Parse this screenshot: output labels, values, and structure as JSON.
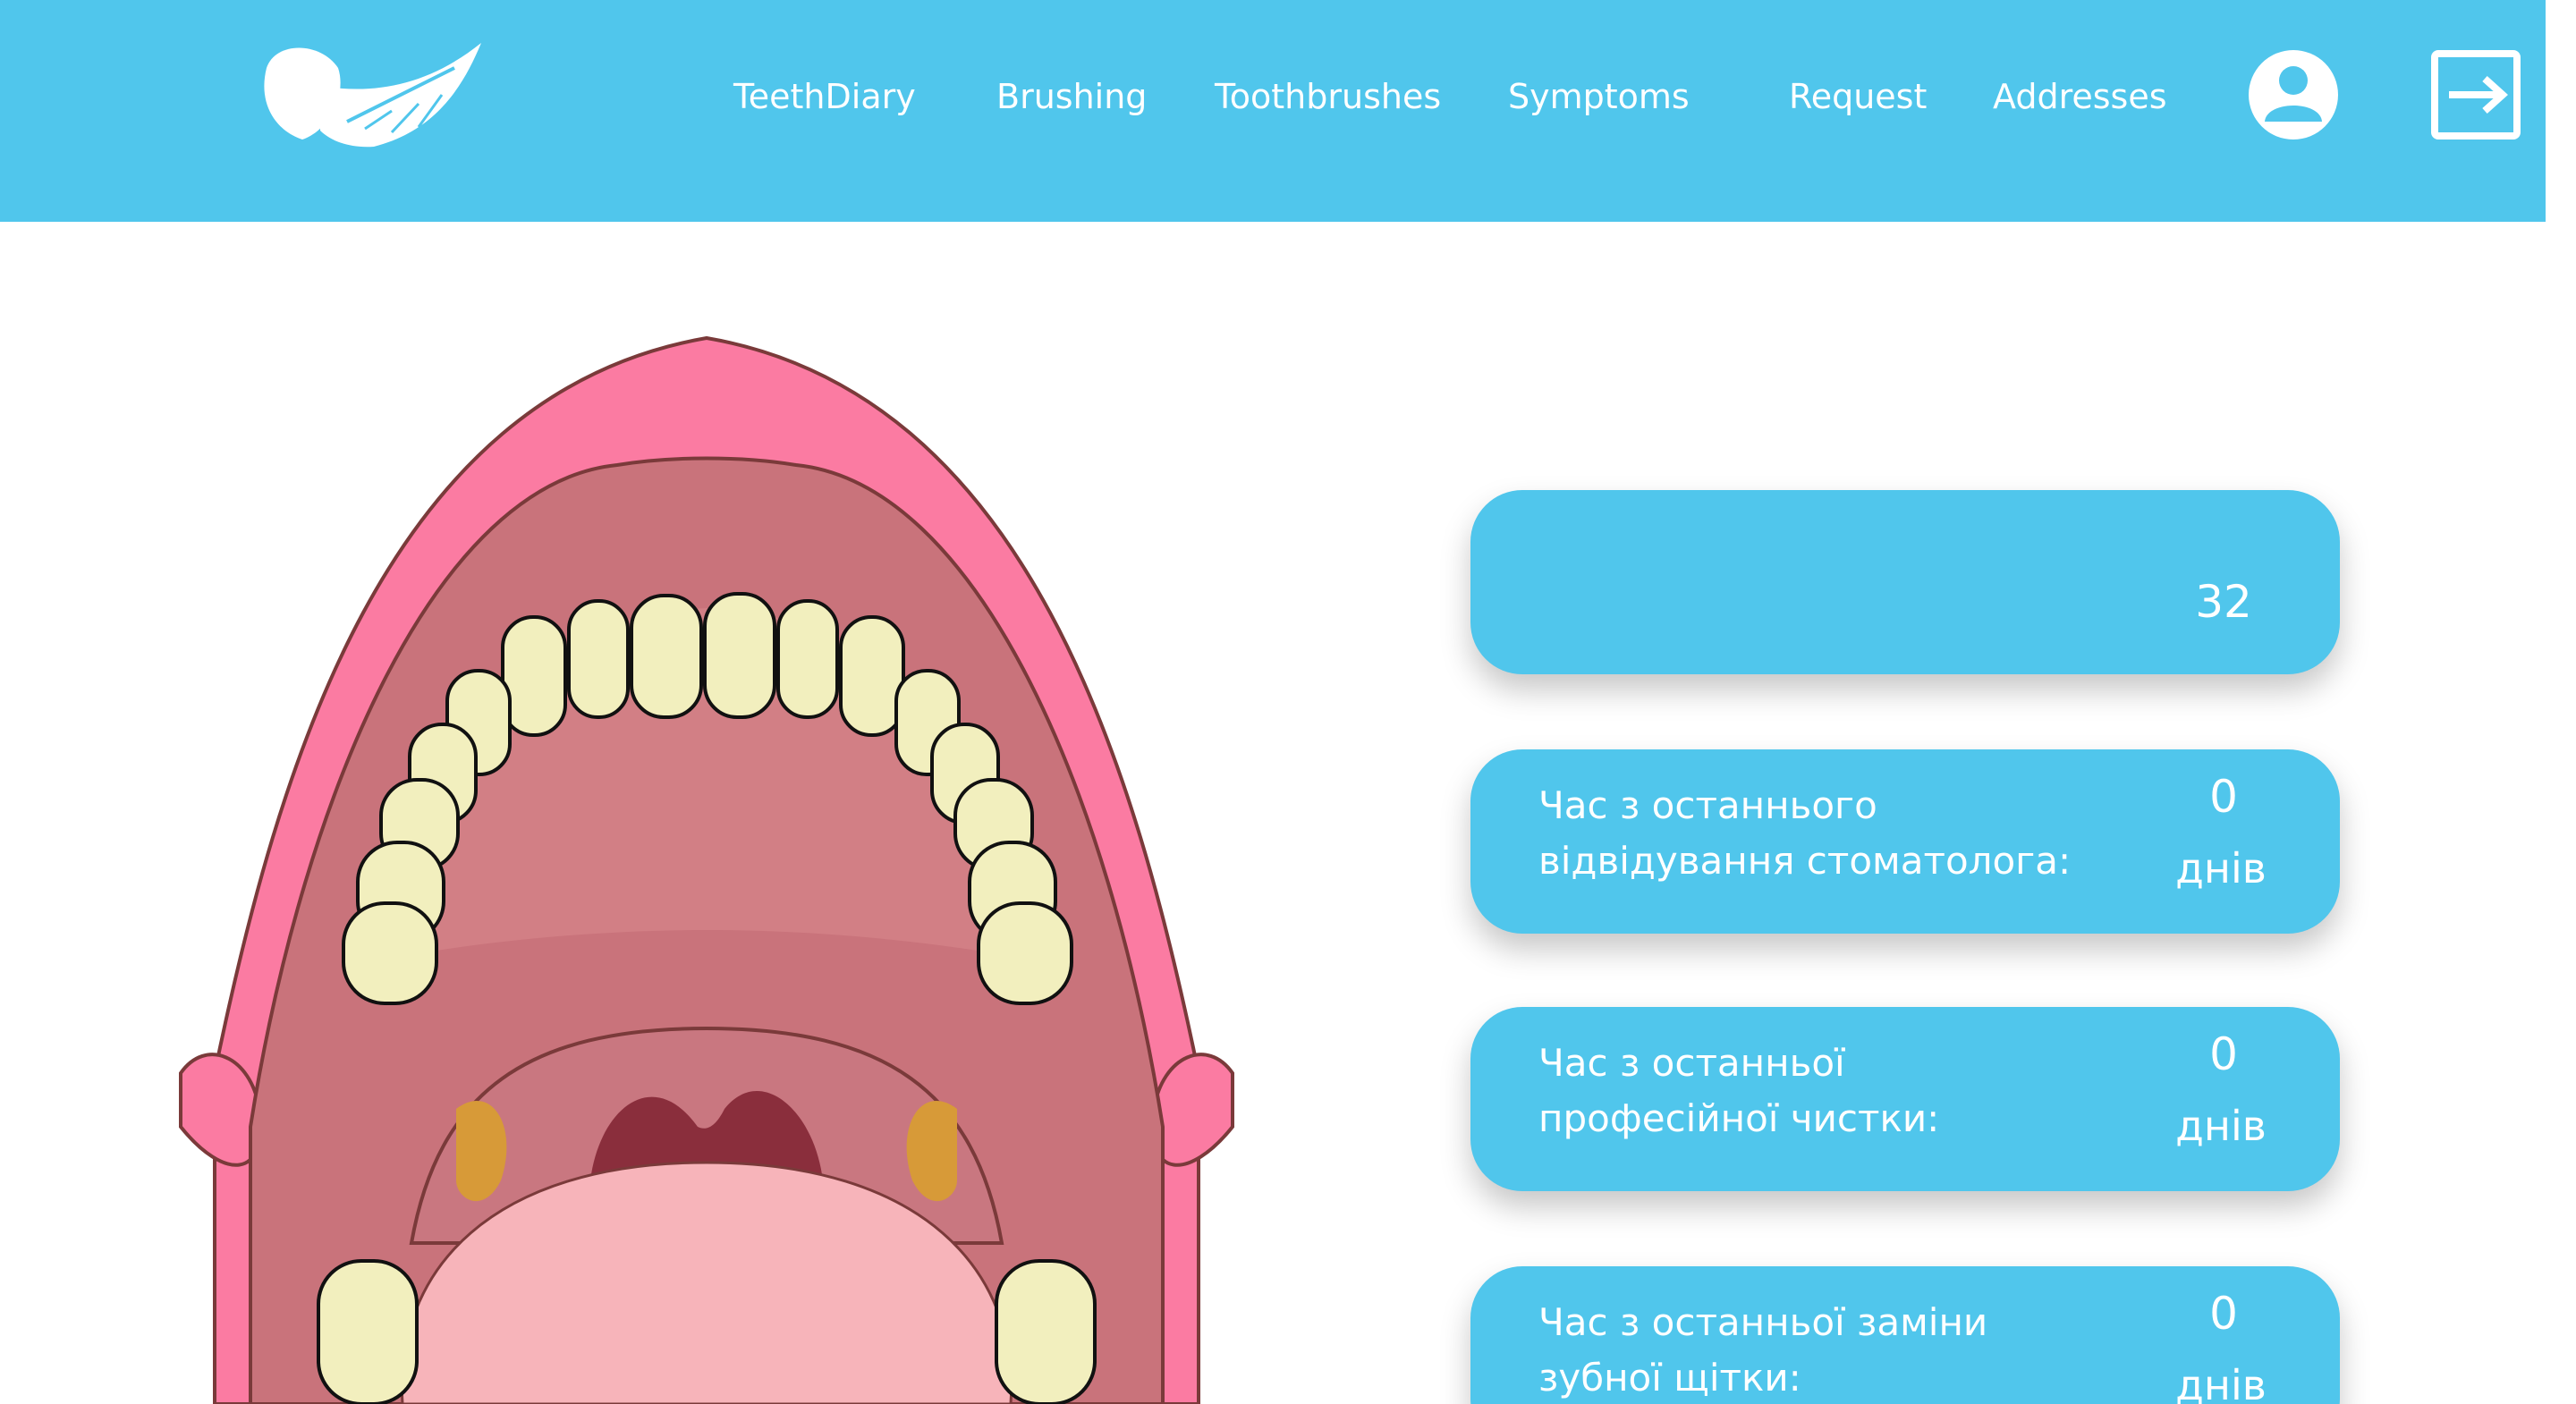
{
  "nav": {
    "items": [
      {
        "label": "TeethDiary"
      },
      {
        "label": "Brushing"
      },
      {
        "label": "Toothbrushes"
      },
      {
        "label": "Symptoms"
      },
      {
        "label": "Request"
      },
      {
        "label": "Addresses"
      }
    ]
  },
  "icons": {
    "logo": "tooth-feather-logo",
    "profile": "user-icon",
    "logout": "logout-icon"
  },
  "stats": {
    "cleaned_label": "",
    "cleaned_value": "",
    "teeth_label": "",
    "teeth_value": "32",
    "dentist_label": "Час з останнього\nвідвідування стоматолога:",
    "dentist_value": "0",
    "dentist_unit": "днів",
    "cleaning_label": "Час з останньої\nпрофесійної чистки:",
    "cleaning_value": "0",
    "cleaning_unit": "днів",
    "brush_label": "Час з останньої заміни\nзубної щітки:",
    "brush_value": "0",
    "brush_unit": "днів"
  },
  "colors": {
    "header": "#50c6ec",
    "card": "#50c6ec",
    "lips": "#fb7ba2",
    "mouth": "#c9737b",
    "tooth": "#f2efbe",
    "tongue": "#f7b4ba"
  }
}
